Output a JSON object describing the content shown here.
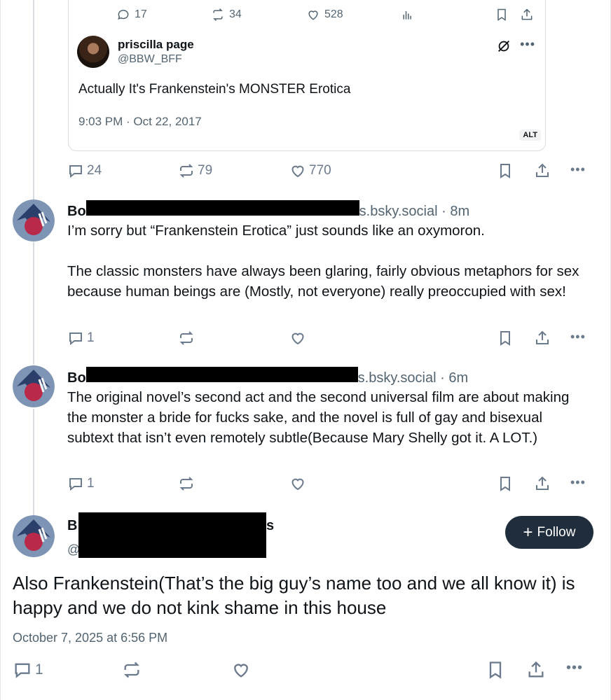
{
  "quoted_post": {
    "stats": {
      "replies": "17",
      "reposts": "34",
      "likes": "528"
    },
    "author_name": "priscilla page",
    "author_handle": "@BBW_BFF",
    "text": "Actually It's Frankenstein's MONSTER Erotica",
    "timestamp": "9:03 PM · Oct 22, 2017",
    "alt_badge": "ALT"
  },
  "root_post_actions": {
    "replies": "24",
    "reposts": "79",
    "likes": "770"
  },
  "replies": [
    {
      "name_prefix": "Bo",
      "handle_suffix": "s.bsky.social · 8m",
      "paragraphs": [
        "I’m sorry but “Frankenstein Erotica” just sounds like an oxymoron.",
        "The classic monsters have always been glaring, fairly obvious metaphors for sex because human beings are (Mostly, not everyone) really preoccupied with sex!"
      ],
      "reply_count": "1"
    },
    {
      "name_prefix": "Bo",
      "handle_suffix": "s.bsky.social · 6m",
      "paragraphs": [
        "The original novel’s second act and the second universal film are about making the monster a bride for fucks sake, and the novel is full of gay and bisexual subtext that isn’t even remotely subtle(Because Mary Shelly got it. A LOT.)"
      ],
      "reply_count": "1"
    }
  ],
  "focused_post": {
    "name_prefix": "B",
    "name_suffix": "s",
    "handle_prefix": "@",
    "follow_label": "Follow",
    "text": "Also Frankenstein(That’s the big guy’s name too and we all know it) is happy and we do not kink shame in this house",
    "timestamp": "October 7, 2025 at 6:56 PM",
    "reply_count": "1"
  },
  "colors": {
    "muted": "#536471",
    "action_icon": "#6b7a8c",
    "follow_bg": "#1f2d3d",
    "thread_line": "#d4dbe2"
  }
}
